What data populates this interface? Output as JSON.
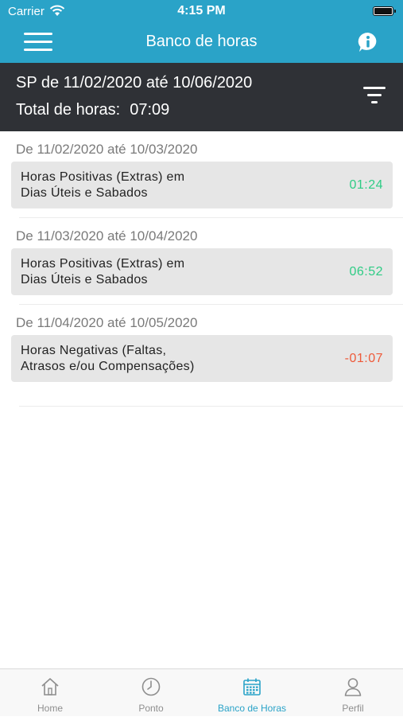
{
  "status_bar": {
    "carrier": "Carrier",
    "time": "4:15 PM"
  },
  "nav": {
    "title": "Banco de horas",
    "menu_icon": "hamburger-icon",
    "info_icon": "info-bubble-icon"
  },
  "summary": {
    "range": "SP de 11/02/2020 até 10/06/2020",
    "total_label": "Total de horas:",
    "total_value": "07:09",
    "filter_icon": "filter-icon"
  },
  "periods": [
    {
      "label": "De 11/02/2020 até 10/03/2020",
      "description": "Horas Positivas (Extras) em Dias Úteis e Sabados",
      "value": "01:24",
      "color": "#2ecc85"
    },
    {
      "label": "De 11/03/2020 até 10/04/2020",
      "description": "Horas Positivas (Extras) em Dias Úteis e Sabados",
      "value": "06:52",
      "color": "#2ecc85"
    },
    {
      "label": "De 11/04/2020 até 10/05/2020",
      "description": "Horas Negativas (Faltas, Atrasos e/ou Compensações)",
      "value": "-01:07",
      "color": "#ee5a3a"
    }
  ],
  "tabs": [
    {
      "label": "Home",
      "icon": "home-icon"
    },
    {
      "label": "Ponto",
      "icon": "clock-icon"
    },
    {
      "label": "Banco de Horas",
      "icon": "calendar-icon",
      "active": true
    },
    {
      "label": "Perfil",
      "icon": "user-icon"
    }
  ],
  "colors": {
    "accent": "#2aa3c8",
    "summary_bg": "#2f3136",
    "positive": "#2ecc85",
    "negative": "#ee5a3a"
  }
}
